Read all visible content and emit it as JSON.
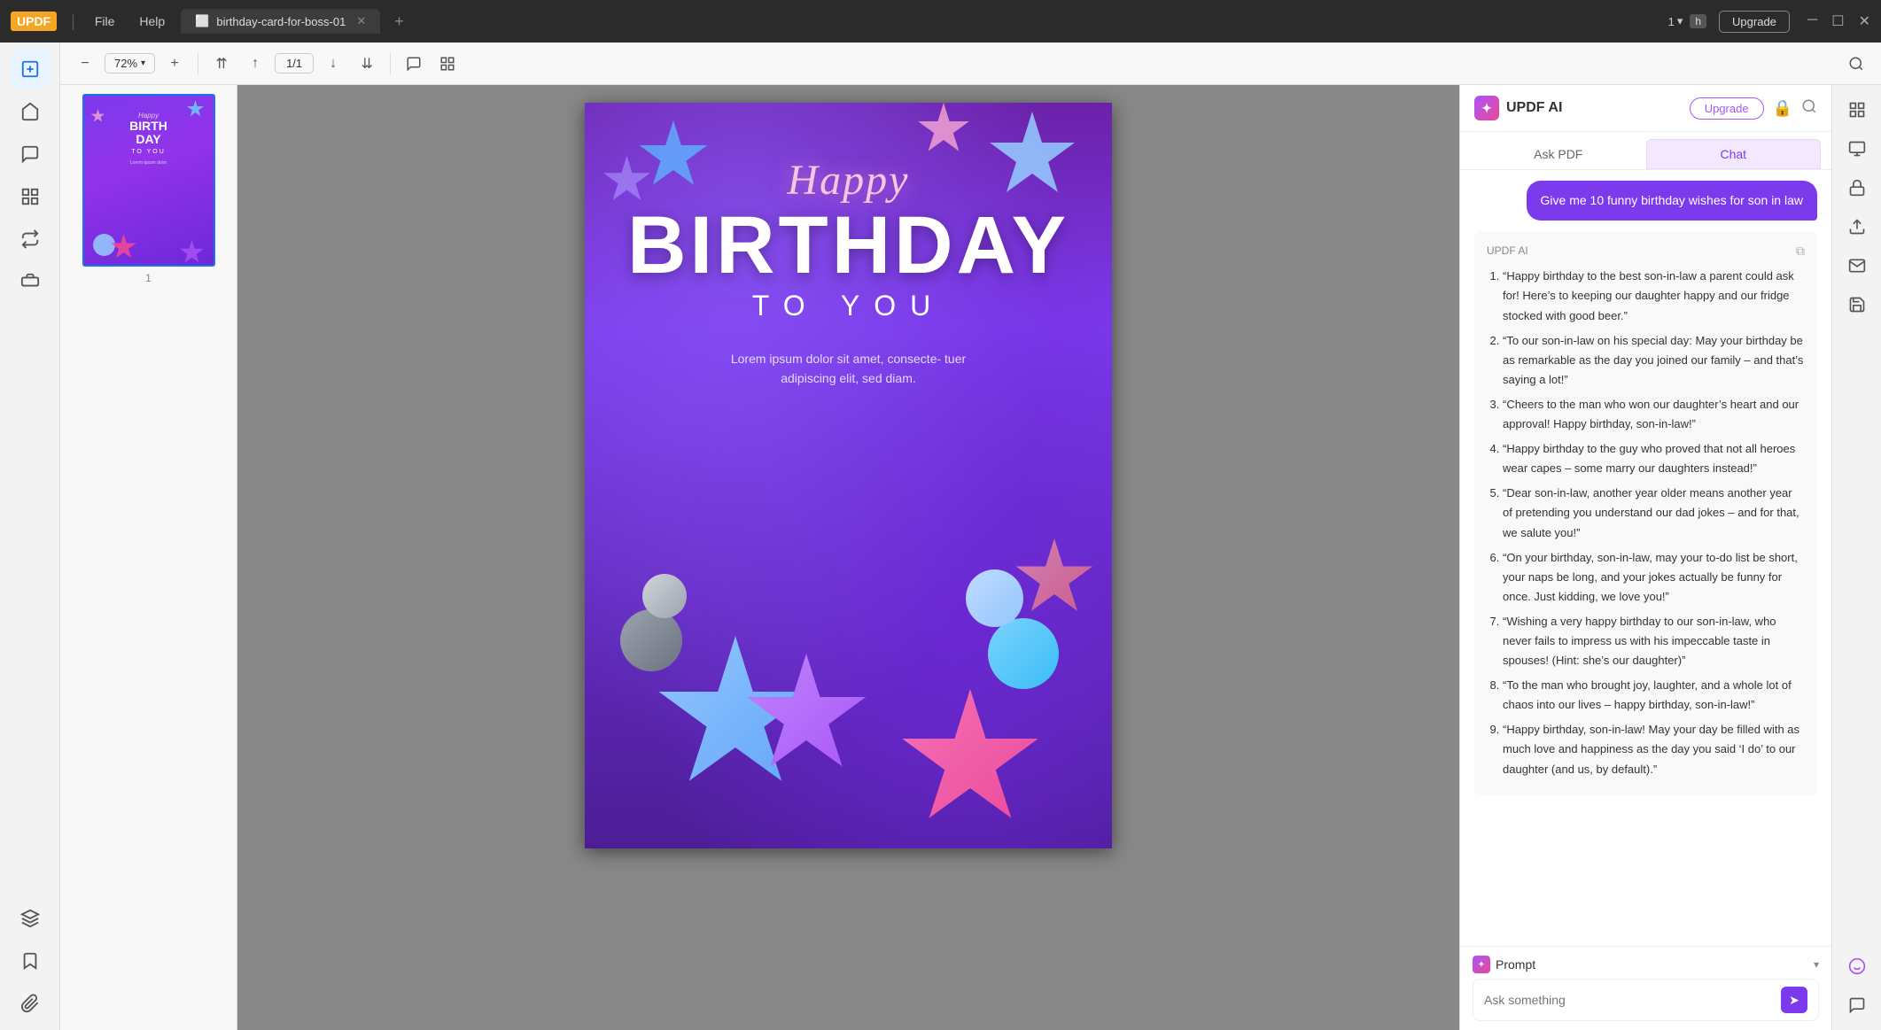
{
  "titlebar": {
    "logo": "UPDF",
    "menu_file": "File",
    "menu_help": "Help",
    "tab_name": "birthday-card-for-boss-01",
    "page_num": "1",
    "upgrade_label": "Upgrade"
  },
  "toolbar": {
    "zoom_level": "72%",
    "page_current": "1",
    "page_total": "1"
  },
  "pdf": {
    "happy_text": "Happy",
    "birthday_text": "BIRTHDAY",
    "toyou_text": "TO YOU",
    "lorem_text": "Lorem ipsum dolor sit amet, consecte-\ntuer adipiscing elit, sed diam."
  },
  "ai_panel": {
    "title": "UPDF AI",
    "upgrade_btn": "Upgrade",
    "tab_ask_pdf": "Ask PDF",
    "tab_chat": "Chat",
    "user_message": "Give me 10 funny birthday wishes for son in law",
    "response_label": "UPDF AI",
    "response_items": [
      "“Happy birthday to the best son-in-law a parent could ask for! Here’s to keeping our daughter happy and our fridge stocked with good beer.”",
      "“To our son-in-law on his special day: May your birthday be as remarkable as the day you joined our family – and that’s saying a lot!”",
      "“Cheers to the man who won our daughter’s heart and our approval! Happy birthday, son-in-law!”",
      "“Happy birthday to the guy who proved that not all heroes wear capes – some marry our daughters instead!”",
      "“Dear son-in-law, another year older means another year of pretending you understand our dad jokes – and for that, we salute you!”",
      "“On your birthday, son-in-law, may your to-do list be short, your naps be long, and your jokes actually be funny for once. Just kidding, we love you!”",
      "“Wishing a very happy birthday to our son-in-law, who never fails to impress us with his impeccable taste in spouses! (Hint: she’s our daughter)”",
      "“To the man who brought joy, laughter, and a whole lot of chaos into our lives – happy birthday, son-in-law!”",
      "“Happy birthday, son-in-law! May your day be filled with as much love and happiness as the day you said ‘I do’ to our daughter (and us, by default).”"
    ],
    "prompt_label": "Prompt",
    "input_placeholder": "Ask something"
  },
  "sidebar": {
    "icons": [
      {
        "name": "edit-icon",
        "symbol": "✏️"
      },
      {
        "name": "reader-icon",
        "symbol": "📖"
      },
      {
        "name": "comment-icon",
        "symbol": "💬"
      },
      {
        "name": "organize-icon",
        "symbol": "📋"
      },
      {
        "name": "convert-icon",
        "symbol": "🔄"
      },
      {
        "name": "stamp-icon",
        "symbol": "🔖"
      },
      {
        "name": "layers-icon",
        "symbol": "⬛"
      },
      {
        "name": "bookmark-icon",
        "symbol": "🔖"
      },
      {
        "name": "attachment-icon",
        "symbol": "📎"
      }
    ]
  },
  "right_sidebar": {
    "icons": [
      {
        "name": "scan-icon",
        "symbol": "⬛"
      },
      {
        "name": "view-icon",
        "symbol": "◻"
      },
      {
        "name": "lock-icon",
        "symbol": "🔒"
      },
      {
        "name": "export-icon",
        "symbol": "↑"
      },
      {
        "name": "mail-icon",
        "symbol": "✉"
      },
      {
        "name": "save-icon",
        "symbol": "⬛"
      }
    ]
  }
}
